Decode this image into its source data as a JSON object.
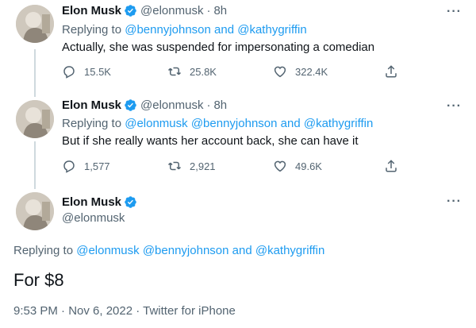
{
  "author": {
    "name": "Elon Musk",
    "handle": "@elonmusk",
    "avatar_icon": "avatar-photo-icon",
    "verified_icon": "verified-badge-icon",
    "verified_color": "#1d9bf0"
  },
  "tweets": [
    {
      "time": "8h",
      "replying_prefix": "Replying to",
      "replying_mentions": [
        "@bennyjohnson",
        "and",
        "@kathygriffin"
      ],
      "text": "Actually, she was suspended for impersonating a comedian",
      "replies": "15.5K",
      "retweets": "25.8K",
      "likes": "322.4K"
    },
    {
      "time": "8h",
      "replying_prefix": "Replying to",
      "replying_mentions": [
        "@elonmusk",
        "@bennyjohnson",
        "and",
        "@kathygriffin"
      ],
      "text": "But if she really wants her account back, she can have it",
      "replies": "1,577",
      "retweets": "2,921",
      "likes": "49.6K"
    }
  ],
  "main_tweet": {
    "replying_prefix": "Replying to",
    "replying_mentions": [
      "@elonmusk",
      "@bennyjohnson",
      "and",
      "@kathygriffin"
    ],
    "text": "For $8",
    "timestamp": "9:53 PM · Nov 6, 2022 · Twitter for iPhone"
  },
  "separator": "·",
  "more_label": "···",
  "colors": {
    "link": "#1d9bf0",
    "muted": "#536471",
    "text": "#0f1419",
    "thread_line": "#cfd9de"
  }
}
